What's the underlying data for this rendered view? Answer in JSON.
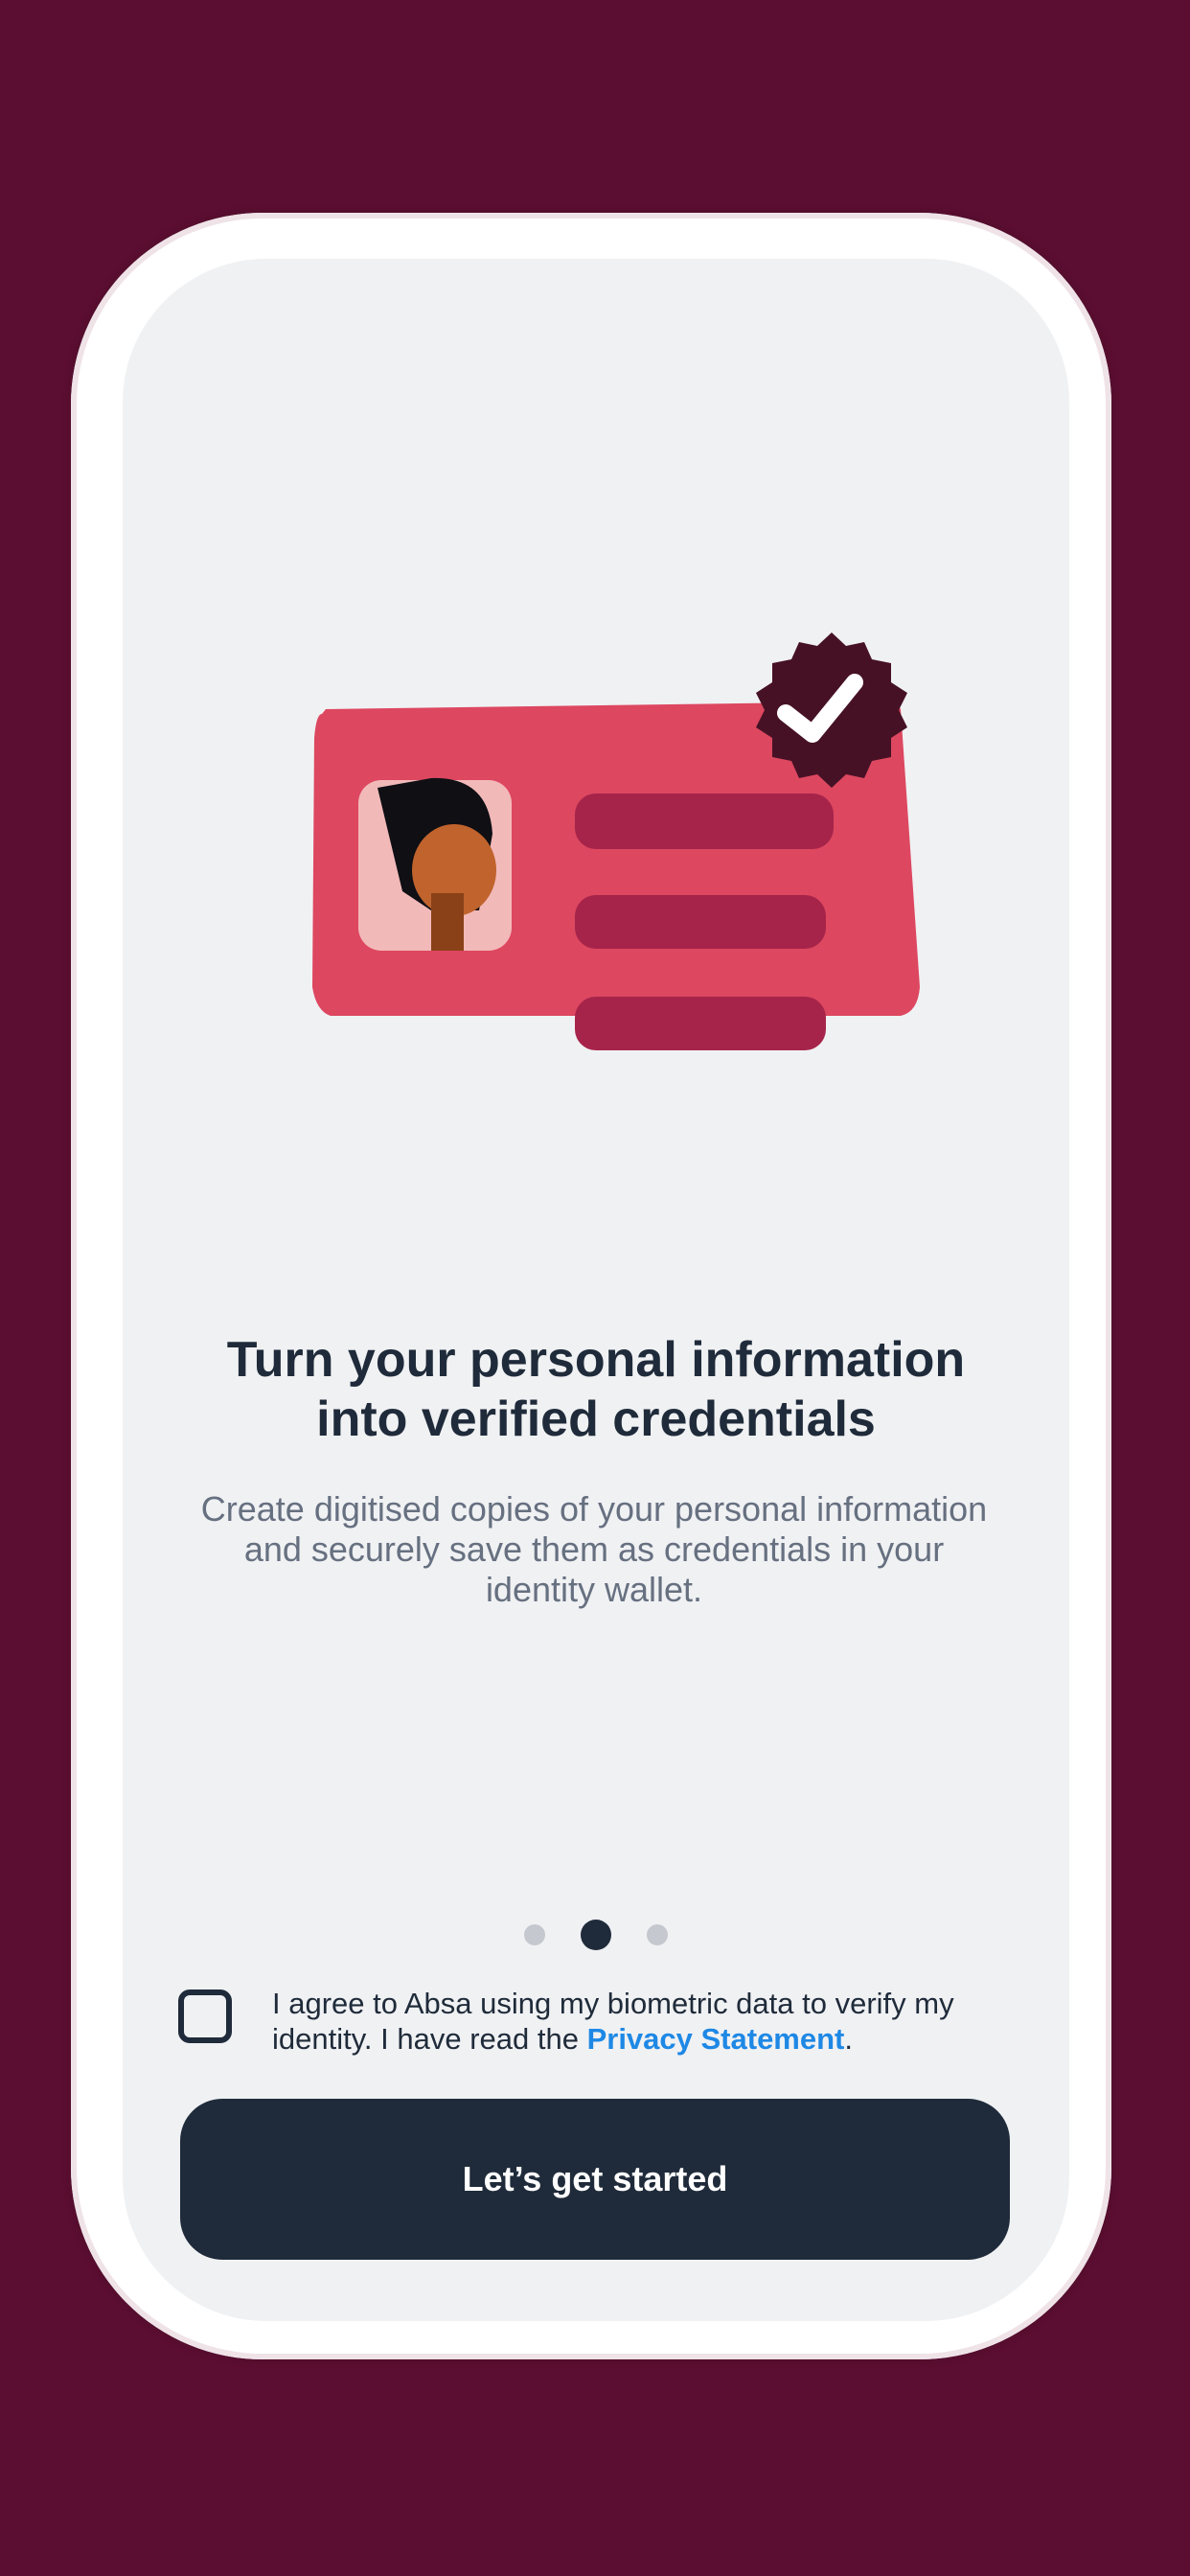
{
  "onboarding": {
    "title_line1": "Turn your personal information",
    "title_line2": "into verified credentials",
    "description_line1": "Create digitised copies of your personal information",
    "description_line2": "and securely save them as credentials in your",
    "description_line3": "identity wallet."
  },
  "pagination": {
    "total": 3,
    "active_index": 1
  },
  "consent": {
    "checked": false,
    "text_line1": "I agree to Absa using my biometric data to verify my",
    "text_prefix_line2": "identity. I have read the ",
    "link_text": "Privacy Statement",
    "text_suffix": "."
  },
  "cta": {
    "label": "Let’s get started"
  },
  "colors": {
    "background": "#5b0e31",
    "screen": "#f0f1f3",
    "card": "#dd4760",
    "card_bars": "#a6244a",
    "badge": "#461125",
    "primary_text": "#1f2b3a",
    "secondary_text": "#667080",
    "link": "#1e88e5",
    "button": "#1f2b3a"
  },
  "icons": {
    "illustration": "verified-id-card-illustration",
    "badge": "check-badge-icon"
  }
}
